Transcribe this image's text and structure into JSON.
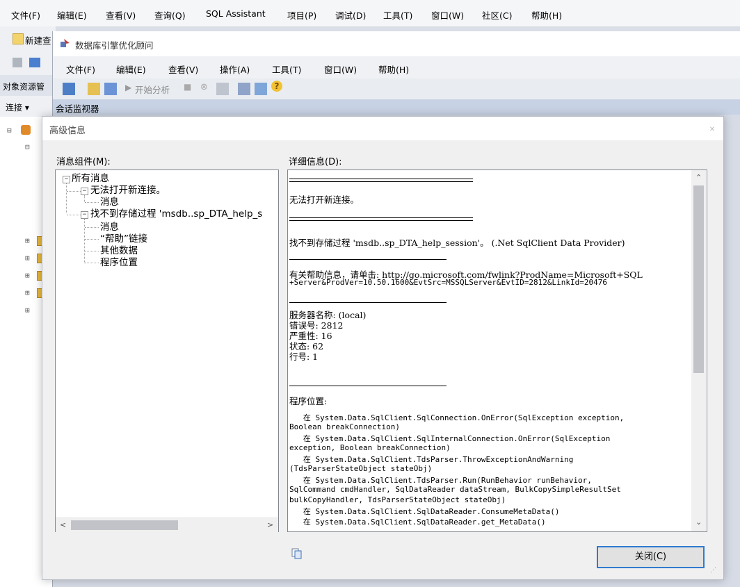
{
  "ssms": {
    "menu": [
      "文件(F)",
      "编辑(E)",
      "查看(V)",
      "查询(Q)",
      "SQL Assistant",
      "项目(P)",
      "调试(D)",
      "工具(T)",
      "窗口(W)",
      "社区(C)",
      "帮助(H)"
    ],
    "toolbar_new": "新建查",
    "object_explorer_title": "对象资源管",
    "connect_label": "连接 ▾"
  },
  "dta": {
    "title": "数据库引擎优化顾问",
    "menu": [
      "文件(F)",
      "编辑(E)",
      "查看(V)",
      "操作(A)",
      "工具(T)",
      "窗口(W)",
      "帮助(H)"
    ],
    "start_analysis": "开始分析",
    "session_monitor": "会话监视器"
  },
  "dialog": {
    "title": "高级信息",
    "components_label": "消息组件(M):",
    "detail_label": "详细信息(D):",
    "tree": {
      "root": "所有消息",
      "node1": "无法打开新连接。",
      "node1_child": "消息",
      "node2": "找不到存储过程 'msdb..sp_DTA_help_s",
      "node2_children": [
        "消息",
        "“帮助”链接",
        "其他数据",
        "程序位置"
      ]
    },
    "detail": {
      "line1": "无法打开新连接。",
      "line2": "找不到存储过程 'msdb..sp_DTA_help_session'。 (.Net SqlClient Data Provider)",
      "help_line1": "有关帮助信息，请单击: http://go.microsoft.com/fwlink?ProdName=Microsoft+SQL",
      "help_line2": "+Server&ProdVer=10.50.1600&EvtSrc=MSSQLServer&EvtID=2812&LinkId=20476",
      "server": "服务器名称: (local)",
      "error_no": "错误号: 2812",
      "severity": "严重性: 16",
      "state": "状态: 62",
      "line_no": "行号: 1",
      "location_label": "程序位置:",
      "stack": [
        "   在 System.Data.SqlClient.SqlConnection.OnError(SqlException exception,",
        "Boolean breakConnection)",
        "   在 System.Data.SqlClient.SqlInternalConnection.OnError(SqlException",
        "exception, Boolean breakConnection)",
        "   在 System.Data.SqlClient.TdsParser.ThrowExceptionAndWarning",
        "(TdsParserStateObject stateObj)",
        "   在 System.Data.SqlClient.TdsParser.Run(RunBehavior runBehavior,",
        "SqlCommand cmdHandler, SqlDataReader dataStream, BulkCopySimpleResultSet",
        "bulkCopyHandler, TdsParserStateObject stateObj)",
        "   在 System.Data.SqlClient.SqlDataReader.ConsumeMetaData()",
        "   在 System.Data.SqlClient.SqlDataReader.get_MetaData()"
      ]
    },
    "close_button": "关闭(C)"
  }
}
